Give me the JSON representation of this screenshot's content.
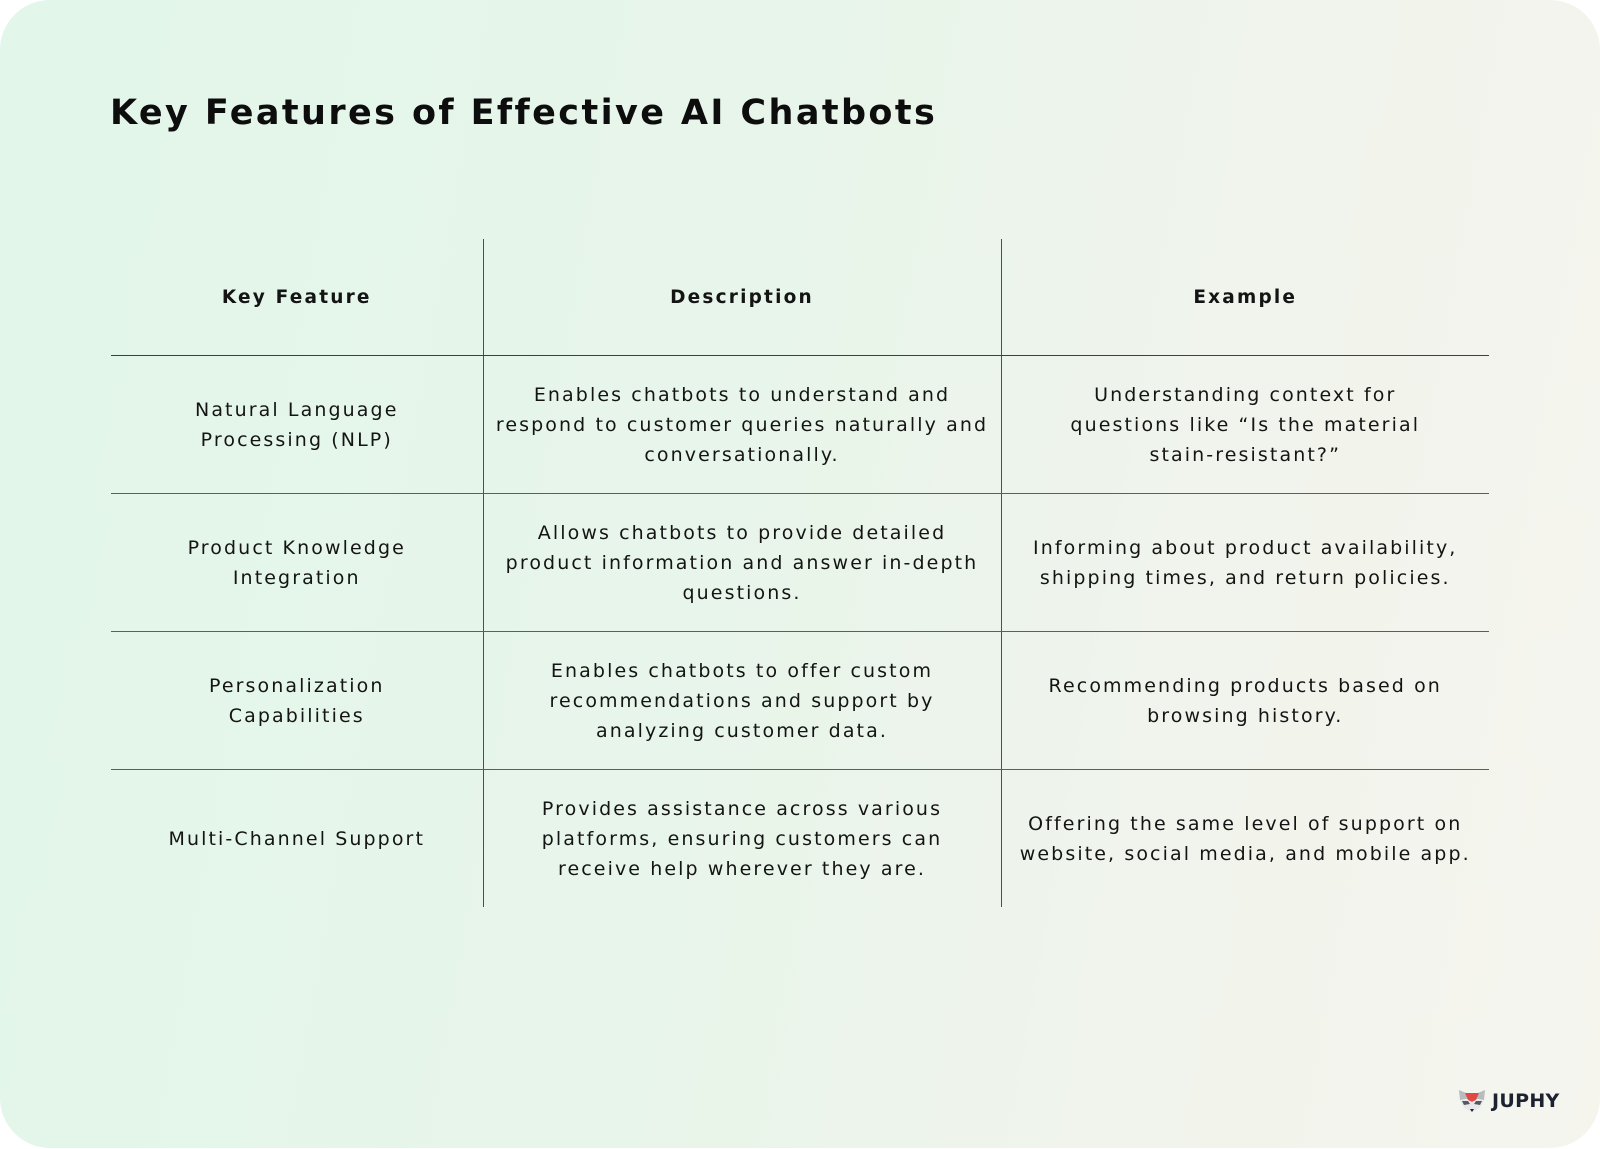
{
  "title": "Key Features of Effective AI Chatbots",
  "table": {
    "headers": [
      "Key Feature",
      "Description",
      "Example"
    ],
    "rows": [
      {
        "feature": "Natural Language Processing (NLP)",
        "description": "Enables chatbots to understand and respond to customer queries naturally and conversationally.",
        "example": "Understanding context for questions like “Is the material stain-resistant?”"
      },
      {
        "feature": "Product Knowledge Integration",
        "description": "Allows chatbots to provide detailed product information and answer in-depth questions.",
        "example": "Informing about product availability, shipping times, and return policies."
      },
      {
        "feature": "Personalization Capabilities",
        "description": "Enables chatbots to offer custom recommendations and support by analyzing customer data.",
        "example": "Recommending products based on browsing history."
      },
      {
        "feature": "Multi-Channel Support",
        "description": "Provides assistance across various platforms, ensuring customers can receive help wherever they are.",
        "example": "Offering the same level of support on website, social media, and mobile app."
      }
    ]
  },
  "logo": {
    "icon": "raccoon-face-icon",
    "text": "JUPHY",
    "colors": {
      "accent": "#e04a44",
      "gray": "#b9bcbf",
      "dark": "#1d2230"
    }
  },
  "colors": {
    "background_left": "#e2f6ea",
    "background_right": "#f5f5ee",
    "text": "#141414",
    "rule": "#4a504a"
  }
}
